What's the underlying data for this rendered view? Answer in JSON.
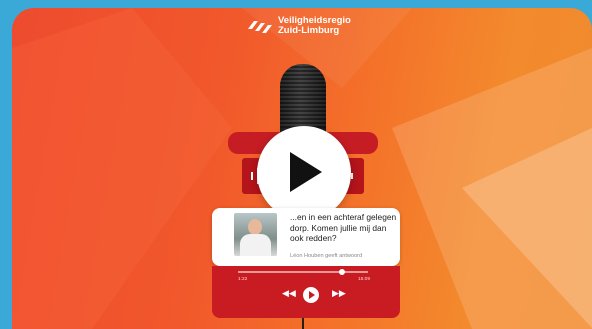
{
  "logo": {
    "line1": "Veiligheidsregio",
    "line2": "Zuid-Limburg"
  },
  "message": {
    "text": "...en in een achteraf gelegen dorp. Komen jullie mij dan ook redden?",
    "subtext": "Léon Houben geeft antwoord"
  },
  "player": {
    "time_left": "1:22",
    "time_right": "15:09",
    "progress": 0.8,
    "rewind_label": "◀◀",
    "forward_label": "▶▶"
  },
  "video": {
    "play_icon": "play-icon"
  },
  "colors": {
    "bg_left": "#ee4b2e",
    "bg_right": "#f08a2e",
    "accent_red": "#c81b22",
    "frame_blue": "#3aa9d8"
  }
}
